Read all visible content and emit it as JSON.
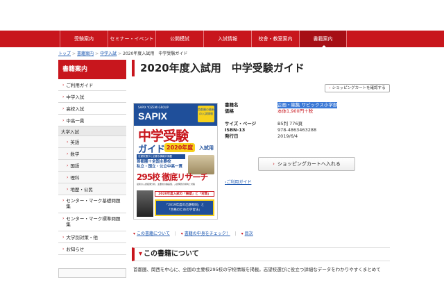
{
  "nav": {
    "items": [
      {
        "label": "受験案内"
      },
      {
        "label": "セミナー・イベント"
      },
      {
        "label": "公開模試"
      },
      {
        "label": "入試情報"
      },
      {
        "label": "校舎・教室案内"
      },
      {
        "label": "書籍案内",
        "active": true
      }
    ]
  },
  "breadcrumb": {
    "items": [
      "トップ",
      "書籍案内",
      "中学入試"
    ],
    "current": "2020年度入試用　中学受験ガイド",
    "separator": ">"
  },
  "sidebar": {
    "title": "書籍案内",
    "items": [
      {
        "label": "ご利用ガイド",
        "type": "item"
      },
      {
        "label": "中学入試",
        "type": "item"
      },
      {
        "label": "高校入試",
        "type": "item"
      },
      {
        "label": "中高一貫",
        "type": "item"
      },
      {
        "label": "大学入試",
        "type": "category"
      },
      {
        "label": "英語",
        "type": "sub"
      },
      {
        "label": "数学",
        "type": "sub"
      },
      {
        "label": "国語",
        "type": "sub"
      },
      {
        "label": "理科",
        "type": "sub"
      },
      {
        "label": "地歴・公民",
        "type": "sub"
      },
      {
        "label": "センター・マーク基礎問題集",
        "type": "tall"
      },
      {
        "label": "センター・マーク標準問題集",
        "type": "tall"
      },
      {
        "label": "大学別対策・他",
        "type": "item"
      },
      {
        "label": "お知らせ",
        "type": "item"
      }
    ]
  },
  "page": {
    "title": "2020年度入試用　中学受験ガイド",
    "cart_check_label": "ショッピングカートを確認する"
  },
  "cover": {
    "group": "SAPIX YOZEMI GROUP",
    "brand": "SAPIX",
    "badge": "首都圏の最新の入試情報",
    "main_title": "中学受験",
    "guide": "ガイド",
    "year": "2020年度",
    "nyushi": "入試用",
    "line1": "志望校選びに必要な情報が満載",
    "line2a": "首都圏＋全国主要校",
    "line2b": "私立・国立・公立中高一貫",
    "count": "295校 徹底リサーチ",
    "small": "最新の入試結果分析、主要校の偏差値、入試問題の傾向と対策",
    "bottom_red": "2020年度入試の「展望」と「対策」",
    "bottom_blue_1": "「2019年度の出題傾向」と",
    "bottom_blue_2": "「合格のための学習法」"
  },
  "info": {
    "rows": [
      {
        "label": "書籍名",
        "value": "企画・編集 サピックス小学部",
        "highlight": true
      },
      {
        "label": "価格",
        "value": "本体1,900円＋税",
        "red": true
      },
      {
        "label": "",
        "value": ""
      },
      {
        "label": "サイズ・ページ",
        "value": "B5判 776頁"
      },
      {
        "label": "ISBN-13",
        "value": "978-4863463288"
      },
      {
        "label": "発行日",
        "value": "2019/6/4"
      }
    ],
    "cart_button": "ショッピングカートへ入れる",
    "guide_link": "ご利用ガイド"
  },
  "bottom_links": [
    "この書籍について",
    "書籍の中身をチェック！",
    "目次"
  ],
  "section": {
    "heading": "この書籍について",
    "description": "首都圏、関西を中心に、全国の主要校295校の学校情報を掲載。志望校選びに役立つ詳細なデータをわかりやすくまとめて"
  },
  "colors": {
    "brand_red": "#c8161d",
    "link_blue": "#1a56b0",
    "highlight": "#3a78d6"
  }
}
